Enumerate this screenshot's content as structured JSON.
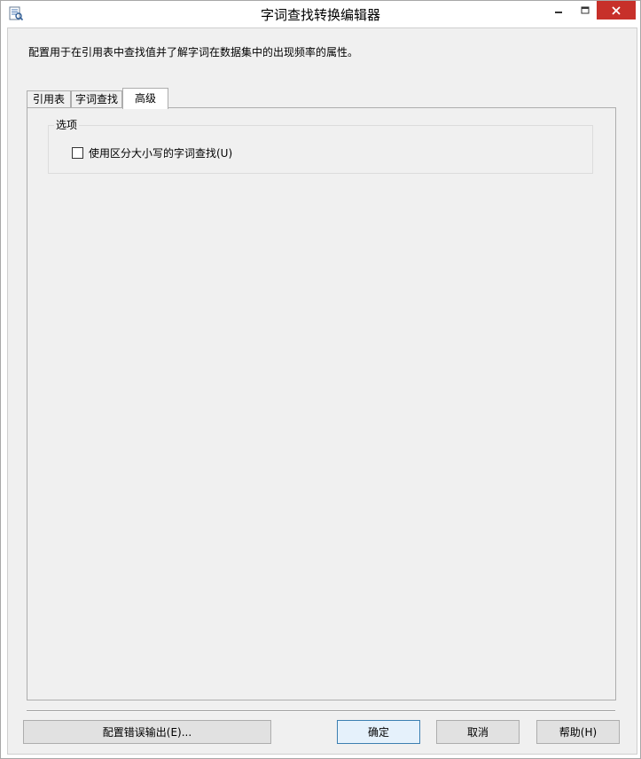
{
  "window": {
    "title": "字词查找转换编辑器"
  },
  "description": "配置用于在引用表中查找值并了解字词在数据集中的出现频率的属性。",
  "tabs": [
    {
      "label": "引用表"
    },
    {
      "label": "字词查找"
    },
    {
      "label": "高级"
    }
  ],
  "active_tab": "高级",
  "options": {
    "group_label": "选项",
    "case_sensitive_label": "使用区分大小写的字词查找(U)",
    "case_sensitive_checked": false
  },
  "buttons": {
    "configure_error_output": "配置错误输出(E)...",
    "ok": "确定",
    "cancel": "取消",
    "help": "帮助(H)"
  },
  "colors": {
    "close_button": "#c7302a",
    "dialog_bg": "#f0f0f0"
  }
}
